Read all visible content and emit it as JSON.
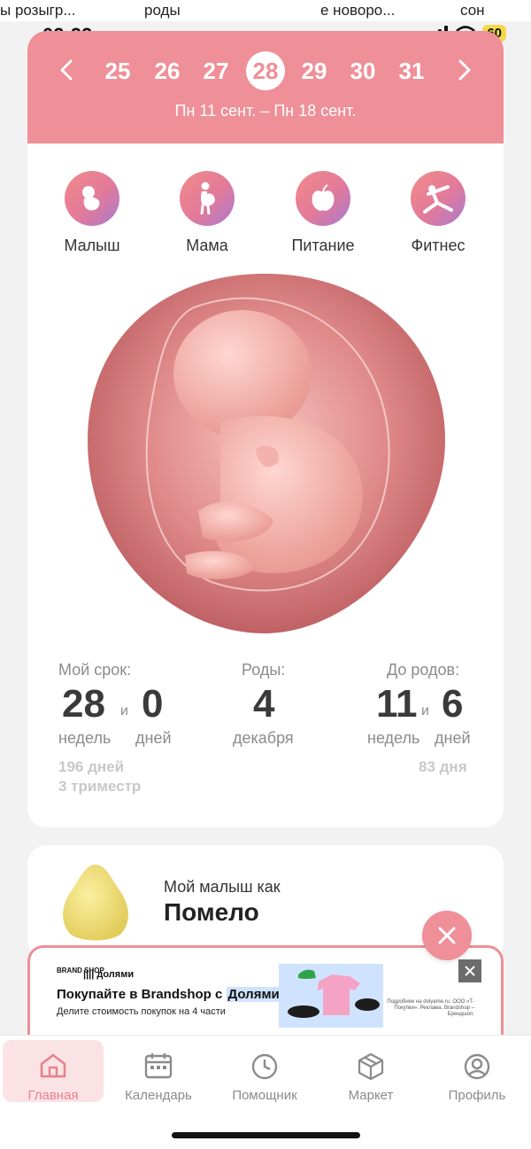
{
  "status_bar": {
    "clipped_texts": [
      "ы розыгр...",
      "роды",
      "е новоро...",
      "сон"
    ],
    "time": "02:22",
    "battery": "60"
  },
  "week_selector": {
    "weeks": [
      "25",
      "26",
      "27",
      "28",
      "29",
      "30",
      "31"
    ],
    "active_week": "28",
    "range": "Пн 11 сент. – Пн 18 сент."
  },
  "categories": [
    {
      "label": "Малыш",
      "icon": "baby-icon"
    },
    {
      "label": "Мама",
      "icon": "pregnant-woman-icon"
    },
    {
      "label": "Питание",
      "icon": "apple-icon"
    },
    {
      "label": "Фитнес",
      "icon": "yoga-pose-icon"
    }
  ],
  "term": {
    "title": "Мой срок:",
    "weeks": "28",
    "and": "и",
    "days": "0",
    "weeks_unit": "недель",
    "days_unit": "дней",
    "total_days": "196 дней",
    "trimester": "3 триместр"
  },
  "due": {
    "title": "Роды:",
    "day": "4",
    "month": "декабря"
  },
  "remaining": {
    "title": "До родов:",
    "weeks": "11",
    "and": "и",
    "days": "6",
    "weeks_unit": "недель",
    "days_unit": "дней",
    "total_days": "83 дня"
  },
  "baby_size": {
    "subtitle": "Мой малыш как",
    "fruit": "Помело"
  },
  "ad": {
    "logo": "BRAND SHOP",
    "partner": "долями",
    "title_prefix": "Покупайте в Brandshop с ",
    "title_highlight": "Долями",
    "subtitle": "Делите стоимость покупок на 4 части",
    "legal": "Подробнее на dolyame.ru. ООО «Т-Покупки». Реклама. Brandshop – Брендшоп."
  },
  "tabbar": {
    "items": [
      {
        "label": "Главная",
        "icon": "home-icon",
        "active": true
      },
      {
        "label": "Календарь",
        "icon": "calendar-icon",
        "active": false
      },
      {
        "label": "Помощник",
        "icon": "clock-icon",
        "active": false
      },
      {
        "label": "Маркет",
        "icon": "box-icon",
        "active": false
      },
      {
        "label": "Профиль",
        "icon": "profile-icon",
        "active": false
      }
    ]
  },
  "colors": {
    "accent": "#ef8f98",
    "accent_light": "#fbe3e5",
    "text_muted": "#8b8b8b"
  }
}
